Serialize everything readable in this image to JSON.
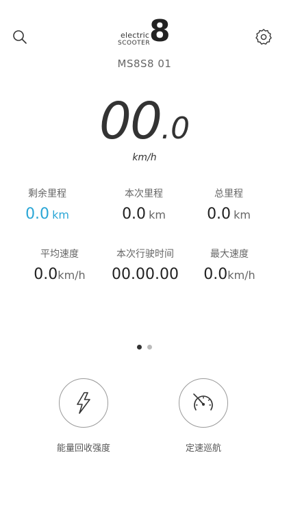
{
  "header": {
    "logo_line1": "electric",
    "logo_line2": "SCOOTER",
    "logo_digit": "8",
    "device_name": "MS8S8 01",
    "search_icon": "search-icon",
    "settings_icon": "gear-icon"
  },
  "speed": {
    "integer": "00",
    "decimal": ".0",
    "unit": "km/h"
  },
  "stats": [
    {
      "label": "剩余里程",
      "value": "0.0",
      "unit": "km",
      "accent": "#2aa6d6"
    },
    {
      "label": "本次里程",
      "value": "0.0",
      "unit": "km"
    },
    {
      "label": "总里程",
      "value": "0.0",
      "unit": "km"
    },
    {
      "label": "平均速度",
      "value": "0.0",
      "unit": "km/h"
    },
    {
      "label": "本次行驶时间",
      "value": "00.00.00",
      "unit": ""
    },
    {
      "label": "最大速度",
      "value": "0.0",
      "unit": "km/h"
    }
  ],
  "pager": {
    "current": 1,
    "total": 2
  },
  "actions": [
    {
      "label": "能量回收强度",
      "icon": "lightning-icon"
    },
    {
      "label": "定速巡航",
      "icon": "speedometer-icon"
    }
  ]
}
